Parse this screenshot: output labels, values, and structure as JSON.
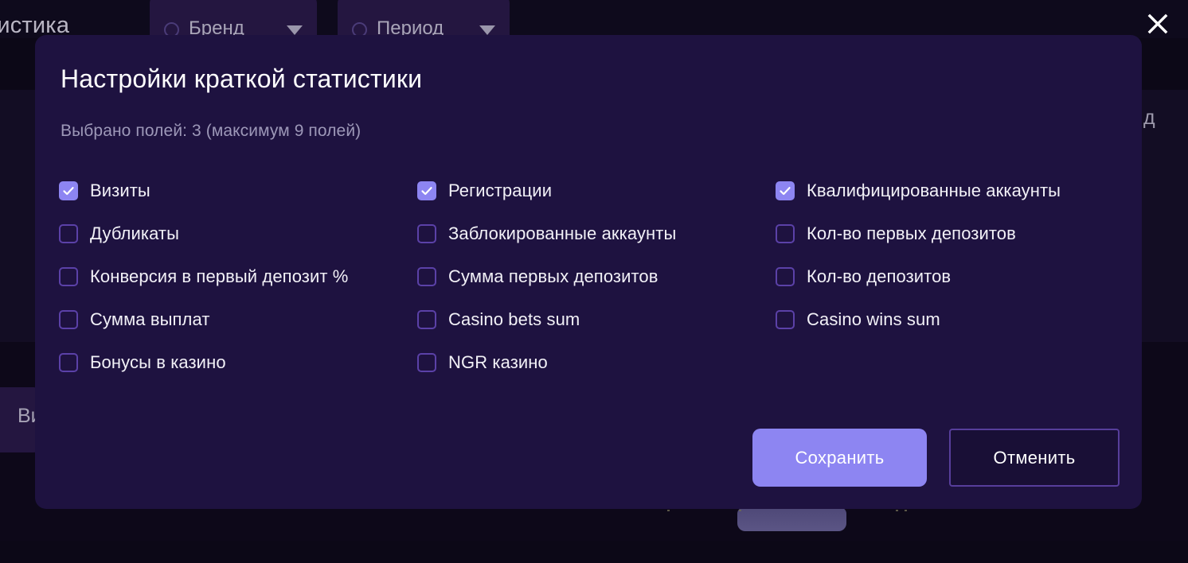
{
  "background": {
    "page_title": "татистика",
    "filters": [
      {
        "label": "Бренд",
        "icon": "circle-icon",
        "caret": "chevron-down-icon"
      },
      {
        "label": "Период",
        "icon": "circle-icon",
        "caret": "chevron-down-icon"
      }
    ],
    "right_label": "д",
    "card_label": "Ви"
  },
  "close": {
    "icon": "close-icon",
    "title": "Закрыть"
  },
  "modal": {
    "title": "Настройки краткой статистики",
    "subtitle": "Выбрано полей: 3 (максимум 9 полей)",
    "selected_count": 3,
    "max_fields": 9,
    "columns": [
      {
        "items": [
          {
            "label": "Визиты",
            "checked": true
          },
          {
            "label": "Дубликаты",
            "checked": false
          },
          {
            "label": "Конверсия в первый депозит %",
            "checked": false
          },
          {
            "label": "Сумма выплат",
            "checked": false
          },
          {
            "label": "Бонусы в казино",
            "checked": false
          }
        ]
      },
      {
        "items": [
          {
            "label": "Регистрации",
            "checked": true
          },
          {
            "label": "Заблокированные аккаунты",
            "checked": false
          },
          {
            "label": "Сумма первых депозитов",
            "checked": false
          },
          {
            "label": "Casino bets sum",
            "checked": false
          },
          {
            "label": "NGR казино",
            "checked": false
          }
        ]
      },
      {
        "items": [
          {
            "label": "Квалифицированные аккаунты",
            "checked": true
          },
          {
            "label": "Кол-во первых депозитов",
            "checked": false
          },
          {
            "label": "Кол-во депозитов",
            "checked": false
          },
          {
            "label": "Casino wins sum",
            "checked": false
          }
        ]
      }
    ],
    "actions": {
      "save_label": "Сохранить",
      "cancel_label": "Отменить"
    }
  },
  "colors": {
    "page_background": "#0c0817",
    "modal_background": "#1e1240",
    "accent": "#8d85f2",
    "checkbox_border": "#5b41a8",
    "subtitle_text": "#9d98b8",
    "label_text": "#f2f1f7",
    "cancel_border": "#573e9b"
  }
}
